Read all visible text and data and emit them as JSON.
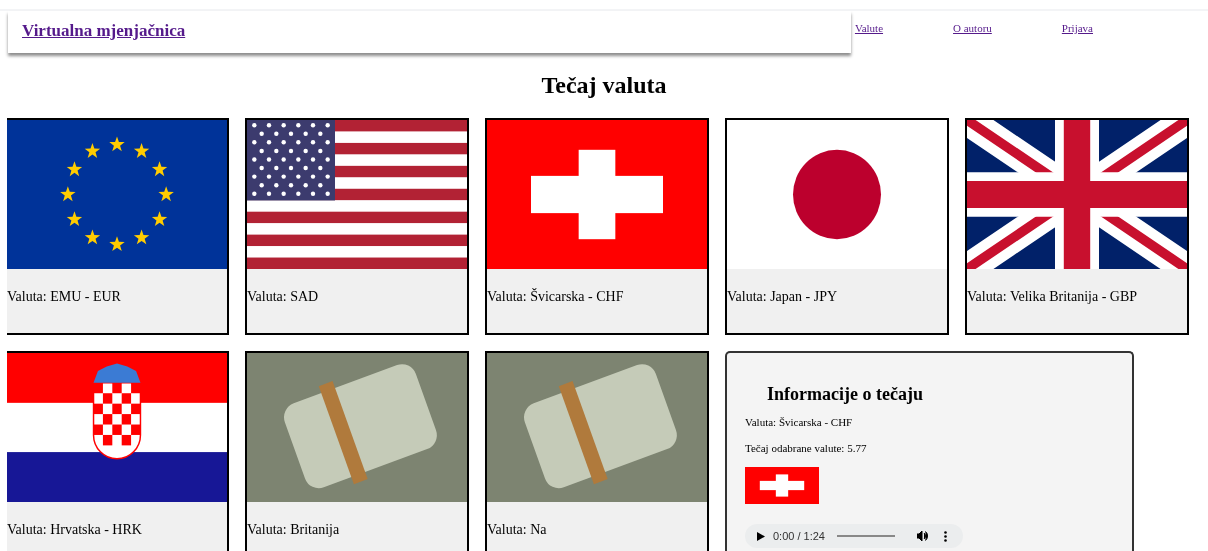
{
  "header": {
    "brand": "Virtualna mjenjačnica",
    "nav": [
      {
        "label": "Valute"
      },
      {
        "label": "O autoru"
      },
      {
        "label": "Prijava"
      }
    ]
  },
  "heading": "Tečaj valuta",
  "cards": [
    {
      "kind": "eu",
      "caption": "Valuta: EMU - EUR"
    },
    {
      "kind": "usa",
      "caption": "Valuta: SAD"
    },
    {
      "kind": "swiss",
      "caption": "Valuta: Švicarska - CHF"
    },
    {
      "kind": "japan",
      "caption": "Valuta: Japan - JPY"
    },
    {
      "kind": "uk",
      "caption": "Valuta: Velika Britanija - GBP"
    },
    {
      "kind": "croatia",
      "caption": "Valuta: Hrvatska - HRK"
    },
    {
      "kind": "photo",
      "caption": "Valuta: Britanija"
    },
    {
      "kind": "photo",
      "caption": "Valuta: Na"
    }
  ],
  "info": {
    "title": "Informacije o tečaju",
    "currency": "Valuta: Švicarska - CHF",
    "rate": "Tečaj odabrane valute: 5.77",
    "flag": {
      "kind": "swiss"
    },
    "audio": {
      "time": "0:00 / 1:24"
    }
  }
}
